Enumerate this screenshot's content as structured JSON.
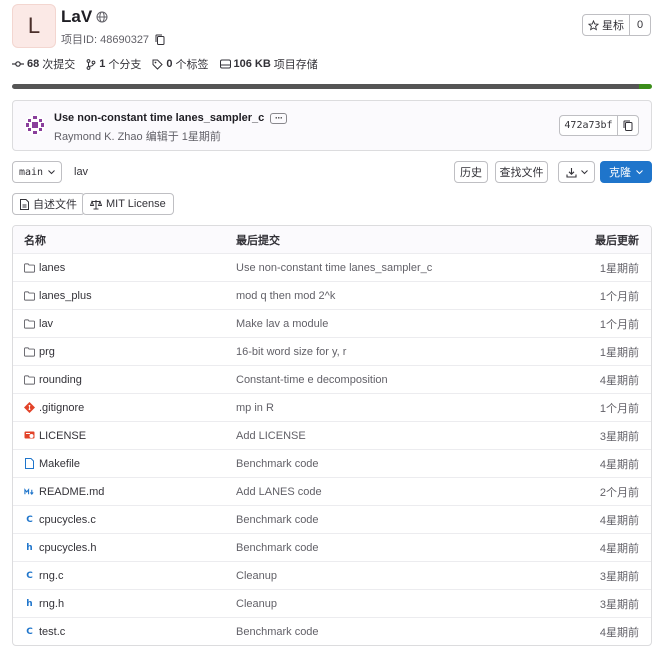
{
  "project": {
    "avatar_letter": "L",
    "name": "LaV",
    "id_text": "项目ID: 48690327",
    "star_label": "星标",
    "star_count": "0"
  },
  "stats": {
    "commits_count": "68",
    "commits_label": "次提交",
    "branches_count": "1",
    "branches_label": "个分支",
    "tags_count": "0",
    "tags_label": "个标签",
    "storage_size": "106 KB",
    "storage_label": "项目存储"
  },
  "languages": [
    {
      "color": "#555555",
      "share": 0.98
    },
    {
      "color": "#3b8d1a",
      "share": 0.02
    }
  ],
  "last_commit": {
    "message": "Use non-constant time lanes_sampler_c",
    "meta": "Raymond K. Zhao 编辑于 1星期前",
    "sha": "472a73bf"
  },
  "toolbar": {
    "branch": "main",
    "path": "lav",
    "history": "历史",
    "find_file": "查找文件",
    "clone": "克隆"
  },
  "chips": {
    "readme": "自述文件",
    "license": "MIT License"
  },
  "table": {
    "headers": {
      "name": "名称",
      "commit": "最后提交",
      "updated": "最后更新"
    },
    "rows": [
      {
        "name": "lanes",
        "icon": "folder-icon",
        "commit": "Use non-constant time lanes_sampler_c",
        "updated": "1星期前"
      },
      {
        "name": "lanes_plus",
        "icon": "folder-icon",
        "commit": "mod q then mod 2^k",
        "updated": "1个月前"
      },
      {
        "name": "lav",
        "icon": "folder-icon",
        "commit": "Make lav a module",
        "updated": "1个月前"
      },
      {
        "name": "prg",
        "icon": "folder-icon",
        "commit": "16-bit word size for y, r",
        "updated": "1星期前"
      },
      {
        "name": "rounding",
        "icon": "folder-icon",
        "commit": "Constant-time e decomposition",
        "updated": "4星期前"
      },
      {
        "name": ".gitignore",
        "icon": "git-icon",
        "commit": "mp in R",
        "updated": "1个月前"
      },
      {
        "name": "LICENSE",
        "icon": "license-icon",
        "commit": "Add LICENSE",
        "updated": "3星期前"
      },
      {
        "name": "Makefile",
        "icon": "file-icon",
        "commit": "Benchmark code",
        "updated": "4星期前"
      },
      {
        "name": "README.md",
        "icon": "markdown-icon",
        "commit": "Add LANES code",
        "updated": "2个月前"
      },
      {
        "name": "cpucycles.c",
        "icon": "c-file-icon",
        "commit": "Benchmark code",
        "updated": "4星期前"
      },
      {
        "name": "cpucycles.h",
        "icon": "h-file-icon",
        "commit": "Benchmark code",
        "updated": "4星期前"
      },
      {
        "name": "rng.c",
        "icon": "c-file-icon",
        "commit": "Cleanup",
        "updated": "3星期前"
      },
      {
        "name": "rng.h",
        "icon": "h-file-icon",
        "commit": "Cleanup",
        "updated": "3星期前"
      },
      {
        "name": "test.c",
        "icon": "c-file-icon",
        "commit": "Benchmark code",
        "updated": "4星期前"
      }
    ]
  }
}
